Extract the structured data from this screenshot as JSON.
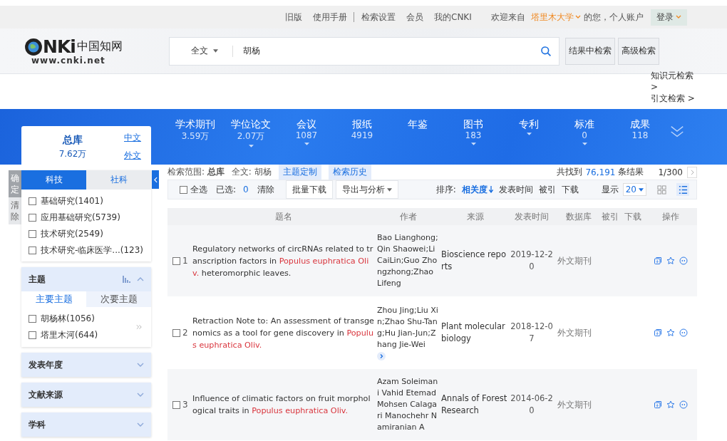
{
  "top_bar": {
    "links": [
      "旧版",
      "使用手册",
      "检索设置",
      "会员",
      "我的CNKI"
    ],
    "welcome": "欢迎来自",
    "institution": "塔里木大学",
    "greeting": "的您，个人账户",
    "login": "登录"
  },
  "header": {
    "logo": {
      "mark": "NKi",
      "name": "中国知网",
      "url": "www.cnki.net"
    },
    "search": {
      "scope": "全文",
      "value": "胡杨"
    },
    "buttons": [
      "结果中检索",
      "高级检索"
    ],
    "side_links": [
      "知识元检索 >",
      "引文检索 >"
    ]
  },
  "databases": {
    "all": {
      "label": "总库",
      "count": "7.62万"
    },
    "languages": [
      "中文",
      "外文"
    ],
    "tabs": [
      {
        "label": "学术期刊",
        "count": "3.59万",
        "dropdown": false
      },
      {
        "label": "学位论文",
        "count": "2.07万",
        "dropdown": true
      },
      {
        "label": "会议",
        "count": "1087",
        "dropdown": true
      },
      {
        "label": "报纸",
        "count": "4919",
        "dropdown": false
      },
      {
        "label": "年鉴",
        "dropdown": false
      },
      {
        "label": "图书",
        "count": "183",
        "dropdown": true
      },
      {
        "label": "专利",
        "dropdown": true
      },
      {
        "label": "标准",
        "count": "0",
        "dropdown": true
      },
      {
        "label": "成果",
        "count": "118",
        "dropdown": false
      }
    ]
  },
  "sidebar": {
    "actions": [
      "确定",
      "清除"
    ],
    "tabs": [
      {
        "label": "科技",
        "selected": true
      },
      {
        "label": "社科",
        "selected": false
      }
    ],
    "items": [
      {
        "label": "基础研究(1401)",
        "checked": false
      },
      {
        "label": "应用基础研究(5739)",
        "checked": false
      },
      {
        "label": "技术研究(2549)",
        "checked": false
      },
      {
        "label": "技术研究-临床医学...(123)",
        "checked": false
      }
    ],
    "facets": [
      {
        "title": "主题",
        "expanded": true,
        "tabs": [
          {
            "label": "主要主题",
            "selected": true
          },
          {
            "label": "次要主题",
            "selected": false
          }
        ],
        "items": [
          {
            "label": "胡杨林(1056)",
            "checked": false
          },
          {
            "label": "塔里木河(644)",
            "checked": false
          }
        ]
      },
      {
        "title": "发表年度",
        "expanded": false
      },
      {
        "title": "文献来源",
        "expanded": false
      },
      {
        "title": "学科",
        "expanded": false
      }
    ]
  },
  "results": {
    "scope": "检索范围: **总库**",
    "query": "全文: 胡杨",
    "actions": [
      "主题定制",
      "检索历史"
    ],
    "found_label": "共找到",
    "total": "76,191",
    "total_suffix": "条结果",
    "page": "1/300",
    "toolbar": {
      "select_all": "全选",
      "select_all_checked": false,
      "selected_label": "已选:",
      "selected_count": "0",
      "clear": "清除",
      "buttons": [
        "批量下载",
        "导出与分析"
      ],
      "sort_label": "排序:",
      "sort_options": [
        {
          "label": "相关度",
          "selected": true
        },
        {
          "label": "发表时间",
          "selected": false
        },
        {
          "label": "被引",
          "selected": false
        },
        {
          "label": "下载",
          "selected": false
        }
      ],
      "page_size_label": "显示",
      "page_size": "20",
      "views": [
        {
          "kind": "grid",
          "selected": false
        },
        {
          "kind": "list",
          "selected": true
        }
      ]
    },
    "columns": [
      "题名",
      "作者",
      "来源",
      "发表时间",
      "数据库",
      "被引",
      "下载",
      "操作"
    ],
    "rows": [
      {
        "number": "1",
        "checked": false,
        "title": [
          {
            "text": "Regulatory networks of circRNAs related to transcription factors in ",
            "highlight": false
          },
          {
            "text": "Populus euphratica Oliv.",
            "highlight": true
          },
          {
            "text": " heteromorphic leaves.",
            "highlight": false
          }
        ],
        "authors": "Bao Lianghong;Qin Shaowei;Li CaiLin;Guo Zhongzhong;Zhao Lifeng",
        "more_authors": false,
        "source": "Bioscience reports",
        "date": "2019-12-20",
        "database": "外文期刊"
      },
      {
        "number": "2",
        "checked": false,
        "title": [
          {
            "text": "Retraction Note to: An assessment of transgenomics as a tool for gene discovery in ",
            "highlight": false
          },
          {
            "text": "Populus euphratica Oliv.",
            "highlight": true
          }
        ],
        "authors": "Zhou Jing;Liu Xin;Zhao Shu-Tang;Hu Jian-Jun;Zhang Jie-Wei",
        "more_authors": true,
        "source": "Plant molecular biology",
        "date": "2018-12-07",
        "database": "外文期刊"
      },
      {
        "number": "3",
        "checked": false,
        "title": [
          {
            "text": "Influence of climatic factors on fruit morphological traits in ",
            "highlight": false
          },
          {
            "text": "Populus euphratica Oliv.",
            "highlight": true
          }
        ],
        "authors": "Azam Soleimani Vahid Etemad Mohsen Calagari Manochehr Namiranian A",
        "more_authors": false,
        "source": "Annals of Forest Research",
        "date": "2014-06-20",
        "database": "外文期刊"
      }
    ]
  }
}
